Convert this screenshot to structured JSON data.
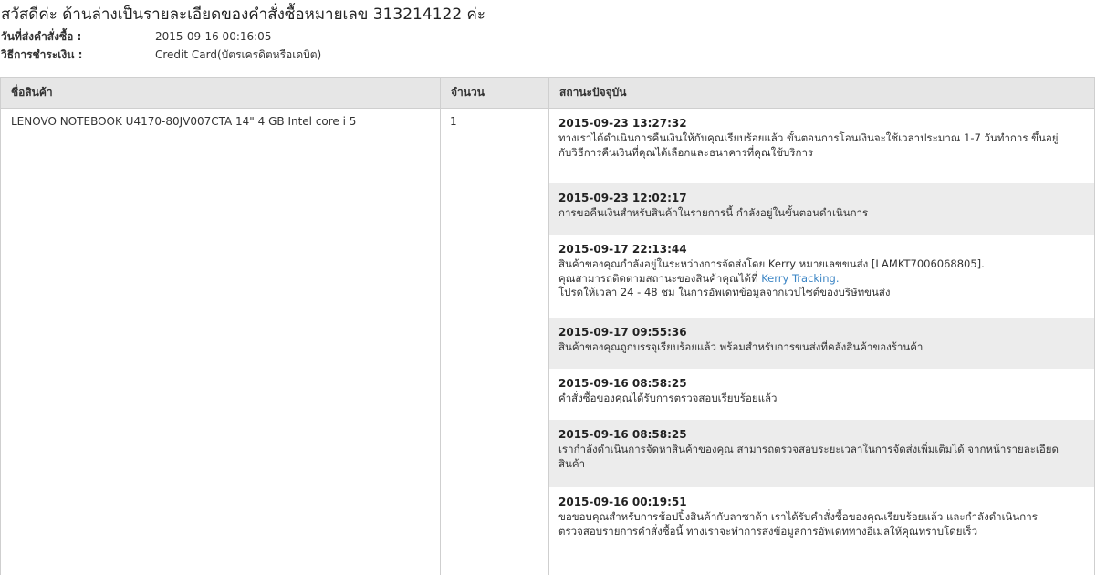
{
  "header": {
    "title": "สวัสดีค่ะ ด้านล่างเป็นรายละเอียดของคำสั่งซื้อหมายเลข 313214122 ค่ะ",
    "order_date_label": "วันที่ส่งคำสั่งซื้อ :",
    "order_date_value": "2015-09-16 00:16:05",
    "payment_label": "วิธีการชำระเงิน :",
    "payment_value": "Credit Card(บัตรเครดิตหรือเดบิต)"
  },
  "table": {
    "col_product": "ชื่อสินค้า",
    "col_qty": "จำนวน",
    "col_status": "สถานะปัจจุบัน",
    "product_name": "LENOVO NOTEBOOK U4170-80JV007CTA 14\" 4 GB Intel core i 5",
    "quantity": "1"
  },
  "status_history": [
    {
      "datetime": "2015-09-23 13:27:32",
      "lines": [
        "ทางเราได้ดำเนินการคืนเงินให้กับคุณเรียบร้อยแล้ว ขั้นตอนการโอนเงินจะใช้เวลาประมาณ 1-7 วันทำการ ขึ้นอยู่",
        "กับวิธีการคืนเงินที่คุณได้เลือกและธนาคารที่คุณใช้บริการ"
      ]
    },
    {
      "datetime": "2015-09-23 12:02:17",
      "lines": [
        "การขอคืนเงินสำหรับสินค้าในรายการนี้ กำลังอยู่ในขั้นตอนดำเนินการ"
      ]
    },
    {
      "datetime": "2015-09-17 22:13:44",
      "lines": [
        "สินค้าของคุณกำลังอยู่ในระหว่างการจัดส่งโดย Kerry หมายเลขขนส่ง [LAMKT7006068805].",
        "คุณสามารถติดตามสถานะของสินค้าคุณได้ที่",
        "โปรดให้เวลา 24 - 48 ชม ในการอัพเดทข้อมูลจากเวปไซต์ของบริษัทขนส่ง"
      ],
      "link_text": "Kerry Tracking."
    },
    {
      "datetime": "2015-09-17 09:55:36",
      "lines": [
        "สินค้าของคุณถูกบรรจุเรียบร้อยแล้ว พร้อมสำหรับการขนส่งที่คลังสินค้าของร้านค้า"
      ]
    },
    {
      "datetime": "2015-09-16 08:58:25",
      "lines": [
        "คำสั่งซื้อของคุณได้รับการตรวจสอบเรียบร้อยแล้ว"
      ]
    },
    {
      "datetime": "2015-09-16 08:58:25",
      "lines": [
        "เรากำลังดำเนินการจัดหาสินค้าของคุณ สามารถตรวจสอบระยะเวลาในการจัดส่งเพิ่มเติมได้ จากหน้ารายละเอียด",
        "สินค้า"
      ]
    },
    {
      "datetime": "2015-09-16 00:19:51",
      "lines": [
        "ขอขอบคุณสำหรับการช้อปปิ้งสินค้ากับลาซาด้า เราได้รับคำสั่งซื้อของคุณเรียบร้อยแล้ว และกำลังดำเนินการ",
        "ตรวจสอบรายการคำสั่งซื้อนี้ ทางเราจะทำการส่งข้อมูลการอัพเดททางอีเมลให้คุณทราบโดยเร็ว"
      ]
    }
  ]
}
